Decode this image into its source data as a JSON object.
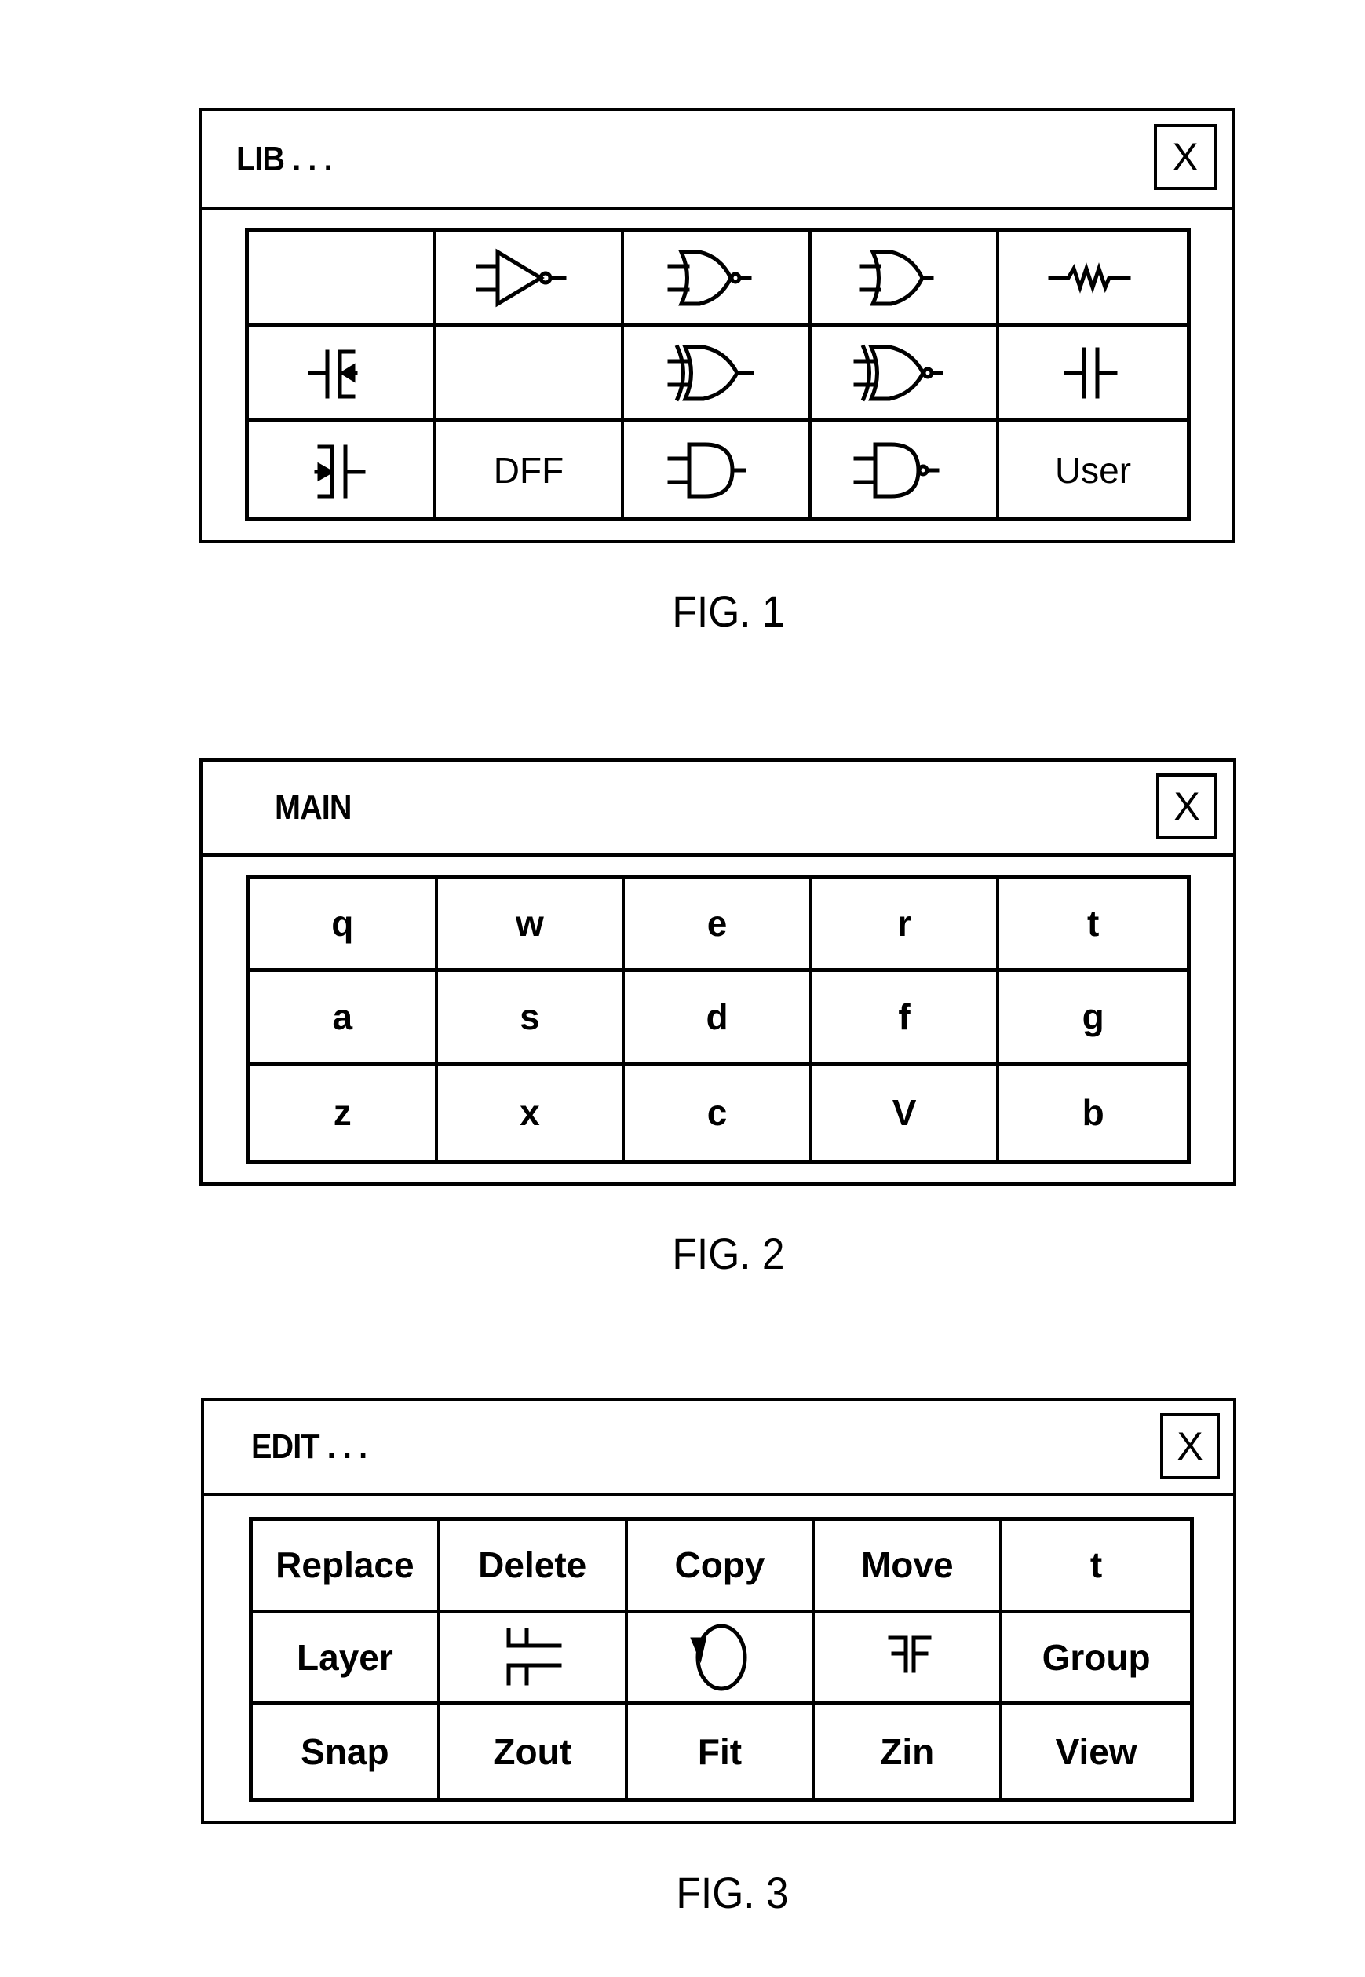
{
  "figures": [
    {
      "title": "LIB . . .",
      "close_label": "X",
      "caption": "FIG. 1",
      "cells": [
        {
          "label": "",
          "icon": "blank"
        },
        {
          "label": "",
          "icon": "inverter-icon"
        },
        {
          "label": "",
          "icon": "nor-gate-icon"
        },
        {
          "label": "",
          "icon": "or-gate-icon"
        },
        {
          "label": "",
          "icon": "resistor-icon"
        },
        {
          "label": "",
          "icon": "nmos-transistor-icon"
        },
        {
          "label": "",
          "icon": "blank"
        },
        {
          "label": "",
          "icon": "xor-gate-icon"
        },
        {
          "label": "",
          "icon": "xnor-gate-icon"
        },
        {
          "label": "",
          "icon": "capacitor-icon"
        },
        {
          "label": "",
          "icon": "pmos-transistor-icon"
        },
        {
          "label": "DFF",
          "icon": ""
        },
        {
          "label": "",
          "icon": "and-gate-icon"
        },
        {
          "label": "",
          "icon": "nand-gate-icon"
        },
        {
          "label": "User",
          "icon": ""
        }
      ]
    },
    {
      "title": "MAIN",
      "close_label": "X",
      "caption": "FIG. 2",
      "cells": [
        {
          "label": "q"
        },
        {
          "label": "w"
        },
        {
          "label": "e"
        },
        {
          "label": "r"
        },
        {
          "label": "t"
        },
        {
          "label": "a"
        },
        {
          "label": "s"
        },
        {
          "label": "d"
        },
        {
          "label": "f"
        },
        {
          "label": "g"
        },
        {
          "label": "z"
        },
        {
          "label": "x"
        },
        {
          "label": "c"
        },
        {
          "label": "V"
        },
        {
          "label": "b"
        }
      ]
    },
    {
      "title": "EDIT . . .",
      "close_label": "X",
      "caption": "FIG. 3",
      "cells": [
        {
          "label": "Replace",
          "icon": ""
        },
        {
          "label": "Delete",
          "icon": ""
        },
        {
          "label": "Copy",
          "icon": ""
        },
        {
          "label": "Move",
          "icon": ""
        },
        {
          "label": "t",
          "icon": ""
        },
        {
          "label": "Layer",
          "icon": ""
        },
        {
          "label": "",
          "icon": "split-horizontal-icon"
        },
        {
          "label": "",
          "icon": "rotate-icon"
        },
        {
          "label": "",
          "icon": "mirror-icon"
        },
        {
          "label": "Group",
          "icon": ""
        },
        {
          "label": "Snap",
          "icon": ""
        },
        {
          "label": "Zout",
          "icon": ""
        },
        {
          "label": "Fit",
          "icon": ""
        },
        {
          "label": "Zin",
          "icon": ""
        },
        {
          "label": "View",
          "icon": ""
        }
      ]
    }
  ]
}
